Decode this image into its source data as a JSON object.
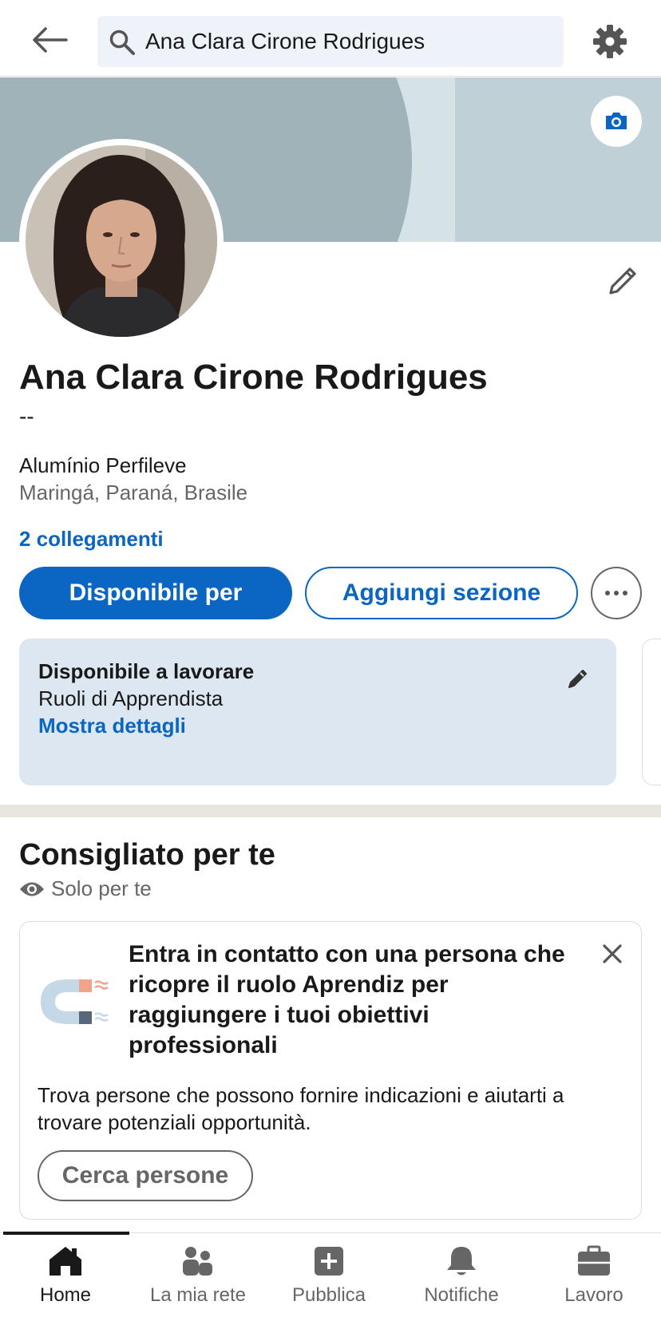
{
  "header": {
    "search_value": "Ana Clara Cirone Rodrigues"
  },
  "profile": {
    "name": "Ana Clara Cirone Rodrigues",
    "headline": "--",
    "company": "Alumínio Perfileve",
    "location": "Maringá, Paraná, Brasile",
    "connections": "2 collegamenti"
  },
  "actions": {
    "primary_label": "Disponibile per",
    "secondary_label": "Aggiungi sezione"
  },
  "open_to_work": {
    "title": "Disponibile a lavorare",
    "role": "Ruoli di Apprendista",
    "link": "Mostra dettagli"
  },
  "recommended": {
    "title": "Consigliato per te",
    "subtitle": "Solo per te",
    "card": {
      "heading": "Entra in contatto con una persona che ricopre il ruolo Aprendiz per raggiungere i tuoi obiettivi professionali",
      "body": "Trova persone che possono fornire indicazioni e aiutarti a trovare potenziali opportunità.",
      "button_label": "Cerca persone"
    }
  },
  "bottom_nav": {
    "items": [
      {
        "label": "Home",
        "icon": "home-icon",
        "active": true
      },
      {
        "label": "La mia rete",
        "icon": "network-icon",
        "active": false
      },
      {
        "label": "Pubblica",
        "icon": "plus-icon",
        "active": false
      },
      {
        "label": "Notifiche",
        "icon": "bell-icon",
        "active": false
      },
      {
        "label": "Lavoro",
        "icon": "briefcase-icon",
        "active": false
      }
    ]
  },
  "colors": {
    "accent": "#0a66c2",
    "banner": "#bfd1d6",
    "open_to_work_bg": "#dde7f1",
    "divider": "#e9e5df"
  }
}
